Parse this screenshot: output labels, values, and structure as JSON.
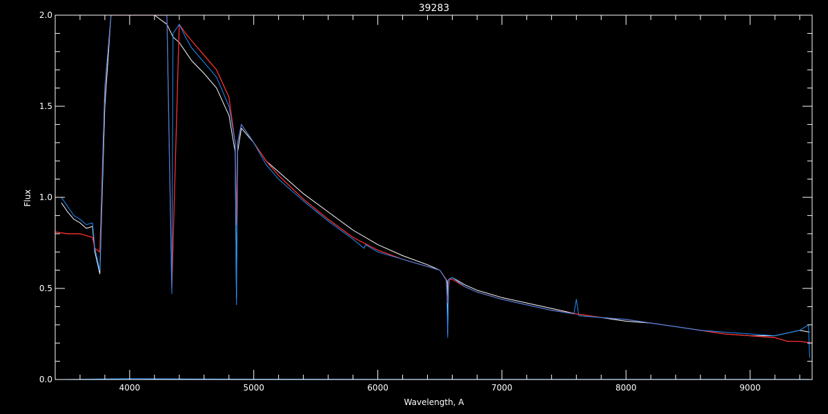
{
  "chart_data": {
    "type": "line",
    "title": "39283",
    "xlabel": "Wavelength, A",
    "ylabel": "Flux",
    "xlim": [
      3400,
      9500
    ],
    "ylim": [
      0.0,
      2.0
    ],
    "x_ticks": [
      {
        "value": 4000,
        "label": "4000"
      },
      {
        "value": 5000,
        "label": "5000"
      },
      {
        "value": 6000,
        "label": "6000"
      },
      {
        "value": 7000,
        "label": "7000"
      },
      {
        "value": 8000,
        "label": "8000"
      },
      {
        "value": 9000,
        "label": "9000"
      }
    ],
    "y_ticks": [
      {
        "value": 0.0,
        "label": "0.0"
      },
      {
        "value": 0.5,
        "label": "0.5"
      },
      {
        "value": 1.0,
        "label": "1.0"
      },
      {
        "value": 1.5,
        "label": "1.5"
      },
      {
        "value": 2.0,
        "label": "2.0"
      }
    ],
    "grid": false,
    "series": [
      {
        "color": "#ffffff",
        "x": [
          3450,
          3500,
          3550,
          3600,
          3650,
          3700,
          3720,
          3760,
          3800,
          3850,
          3900,
          4000,
          4100,
          4200,
          4300,
          4350,
          4400,
          4450,
          4500,
          4600,
          4700,
          4800,
          4850,
          4860,
          4870,
          4900,
          5000,
          5100,
          5200,
          5400,
          5600,
          5800,
          6000,
          6200,
          6400,
          6500,
          6560,
          6563,
          6570,
          6600,
          6700,
          6800,
          7000,
          7200,
          7400,
          7600,
          7800,
          8000,
          8200,
          8400,
          8600,
          8800,
          9000,
          9200,
          9400,
          9480
        ],
        "y": [
          0.97,
          0.92,
          0.88,
          0.86,
          0.83,
          0.84,
          0.7,
          0.58,
          1.5,
          2.0,
          2.0,
          2.0,
          2.0,
          2.0,
          1.95,
          1.88,
          1.85,
          1.8,
          1.75,
          1.68,
          1.6,
          1.45,
          1.25,
          0.45,
          1.25,
          1.38,
          1.3,
          1.2,
          1.14,
          1.02,
          0.92,
          0.82,
          0.74,
          0.68,
          0.63,
          0.6,
          0.54,
          0.25,
          0.55,
          0.56,
          0.52,
          0.49,
          0.45,
          0.42,
          0.39,
          0.36,
          0.34,
          0.32,
          0.31,
          0.29,
          0.27,
          0.25,
          0.24,
          0.24,
          0.27,
          0.26
        ]
      },
      {
        "color": "#ff3030",
        "x": [
          3400,
          3500,
          3600,
          3650,
          3700,
          3720,
          3760,
          3800,
          3850,
          3900,
          4000,
          4100,
          4200,
          4300,
          4340,
          4400,
          4450,
          4500,
          4600,
          4700,
          4800,
          4850,
          4861,
          4870,
          4900,
          5000,
          5100,
          5200,
          5400,
          5600,
          5800,
          6000,
          6200,
          6400,
          6500,
          6550,
          6563,
          6575,
          6600,
          6700,
          6800,
          7000,
          7200,
          7400,
          7600,
          7800,
          8000,
          8200,
          8400,
          8600,
          8800,
          9000,
          9200,
          9300,
          9400,
          9500
        ],
        "y": [
          0.81,
          0.8,
          0.8,
          0.79,
          0.78,
          0.72,
          0.7,
          1.6,
          2.0,
          2.0,
          2.0,
          2.0,
          2.0,
          2.0,
          0.5,
          1.95,
          1.9,
          1.86,
          1.78,
          1.7,
          1.55,
          1.3,
          0.85,
          1.3,
          1.4,
          1.3,
          1.2,
          1.12,
          0.99,
          0.88,
          0.78,
          0.71,
          0.66,
          0.62,
          0.6,
          0.55,
          0.42,
          0.55,
          0.55,
          0.51,
          0.48,
          0.44,
          0.41,
          0.38,
          0.36,
          0.34,
          0.33,
          0.31,
          0.29,
          0.27,
          0.25,
          0.24,
          0.23,
          0.21,
          0.21,
          0.2
        ]
      },
      {
        "color": "#1e90ff",
        "x": [
          3450,
          3500,
          3550,
          3600,
          3650,
          3700,
          3720,
          3760,
          3800,
          3850,
          3900,
          4000,
          4100,
          4200,
          4300,
          4340,
          4350,
          4400,
          4450,
          4500,
          4600,
          4700,
          4800,
          4850,
          4861,
          4870,
          4900,
          5000,
          5100,
          5200,
          5400,
          5600,
          5800,
          5890,
          5900,
          6000,
          6200,
          6400,
          6500,
          6555,
          6563,
          6570,
          6600,
          6700,
          6800,
          7000,
          7200,
          7400,
          7580,
          7600,
          7620,
          7800,
          8000,
          8200,
          8400,
          8600,
          8800,
          9000,
          9200,
          9400,
          9470,
          9480
        ],
        "y": [
          1.0,
          0.95,
          0.9,
          0.88,
          0.85,
          0.86,
          0.72,
          0.6,
          1.6,
          2.0,
          2.0,
          2.0,
          2.0,
          2.0,
          2.0,
          0.47,
          1.9,
          1.95,
          1.88,
          1.82,
          1.74,
          1.66,
          1.5,
          1.3,
          0.41,
          1.3,
          1.4,
          1.3,
          1.18,
          1.1,
          0.98,
          0.87,
          0.77,
          0.72,
          0.74,
          0.7,
          0.66,
          0.62,
          0.6,
          0.54,
          0.23,
          0.55,
          0.56,
          0.51,
          0.48,
          0.44,
          0.41,
          0.38,
          0.36,
          0.44,
          0.35,
          0.34,
          0.33,
          0.31,
          0.29,
          0.27,
          0.26,
          0.25,
          0.24,
          0.27,
          0.3,
          0.12
        ]
      },
      {
        "color": "#1e90ff",
        "x": [
          3450,
          4000,
          4500,
          5000,
          6000,
          7000,
          8000,
          9000,
          9480
        ],
        "y": [
          0.0,
          0.005,
          0.003,
          0.002,
          0.001,
          0.001,
          0.001,
          0.001,
          0.001
        ]
      }
    ]
  }
}
